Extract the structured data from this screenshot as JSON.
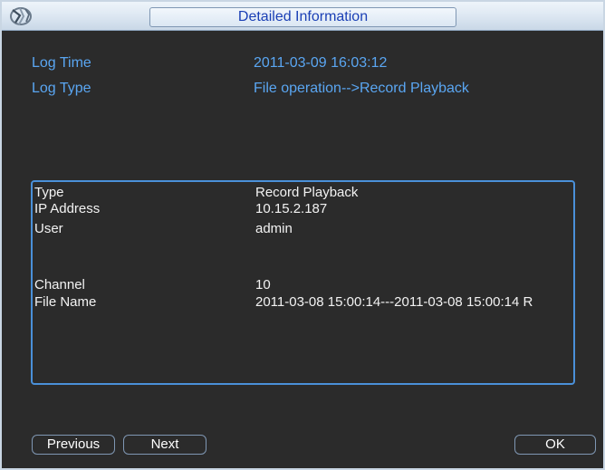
{
  "window": {
    "title": "Detailed Information",
    "logo_icon": "dahua-logo-icon"
  },
  "log": {
    "time_label": "Log Time",
    "time_value": "2011-03-09 16:03:12",
    "type_label": "Log Type",
    "type_value": "File operation-->Record Playback"
  },
  "details": {
    "type_label": "Type",
    "type_value": "Record Playback",
    "ip_label": "IP Address",
    "ip_value": "10.15.2.187",
    "user_label": "User",
    "user_value": "admin",
    "channel_label": "Channel",
    "channel_value": "10",
    "file_label": "File Name",
    "file_value": "2011-03-08 15:00:14---2011-03-08 15:00:14 R"
  },
  "buttons": {
    "previous": "Previous",
    "next": "Next",
    "ok": "OK"
  },
  "colors": {
    "background": "#2b2b2b",
    "label_blue": "#5aa6f2",
    "title_text": "#1a3fb5",
    "border_blue": "#4a90d9"
  }
}
